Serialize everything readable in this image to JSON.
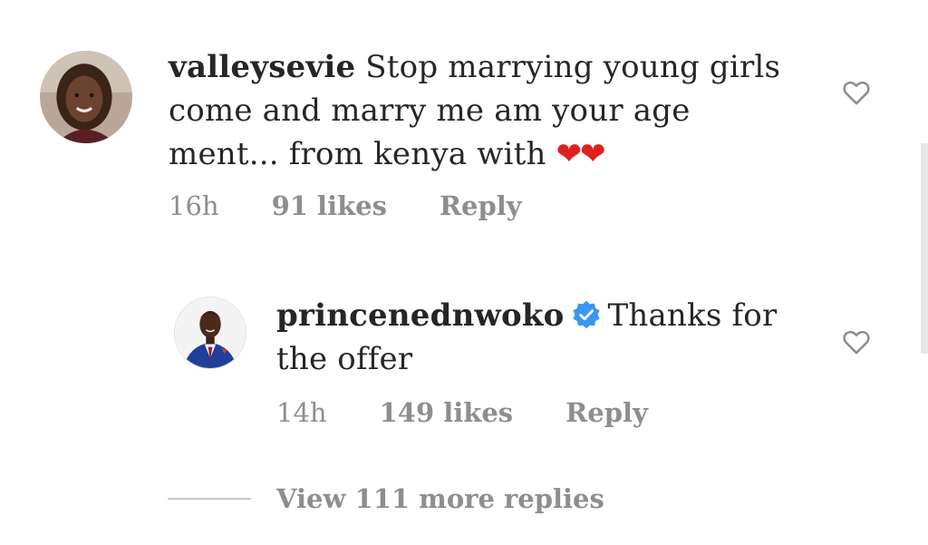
{
  "comment": {
    "username": "valleysevie",
    "text_line1": " Stop marrying young girls",
    "text_line2": "come and marry me am your age",
    "text_line3": "ment... from kenya with ",
    "hearts": "❤❤",
    "time": "16h",
    "likes": "91 likes",
    "reply_label": "Reply",
    "like_icon": "heart-outline-icon"
  },
  "reply": {
    "username": "princenednwoko",
    "verified_icon": "verified-badge-icon",
    "text_line1": "Thanks for",
    "text_line2": "the offer",
    "time": "14h",
    "likes": "149 likes",
    "reply_label": "Reply",
    "like_icon": "heart-outline-icon"
  },
  "view_replies": {
    "label": "View 111 more replies"
  },
  "colors": {
    "text": "#262626",
    "meta": "#8e8e8e",
    "verified": "#3897f0",
    "hearts": "#e0201f"
  }
}
